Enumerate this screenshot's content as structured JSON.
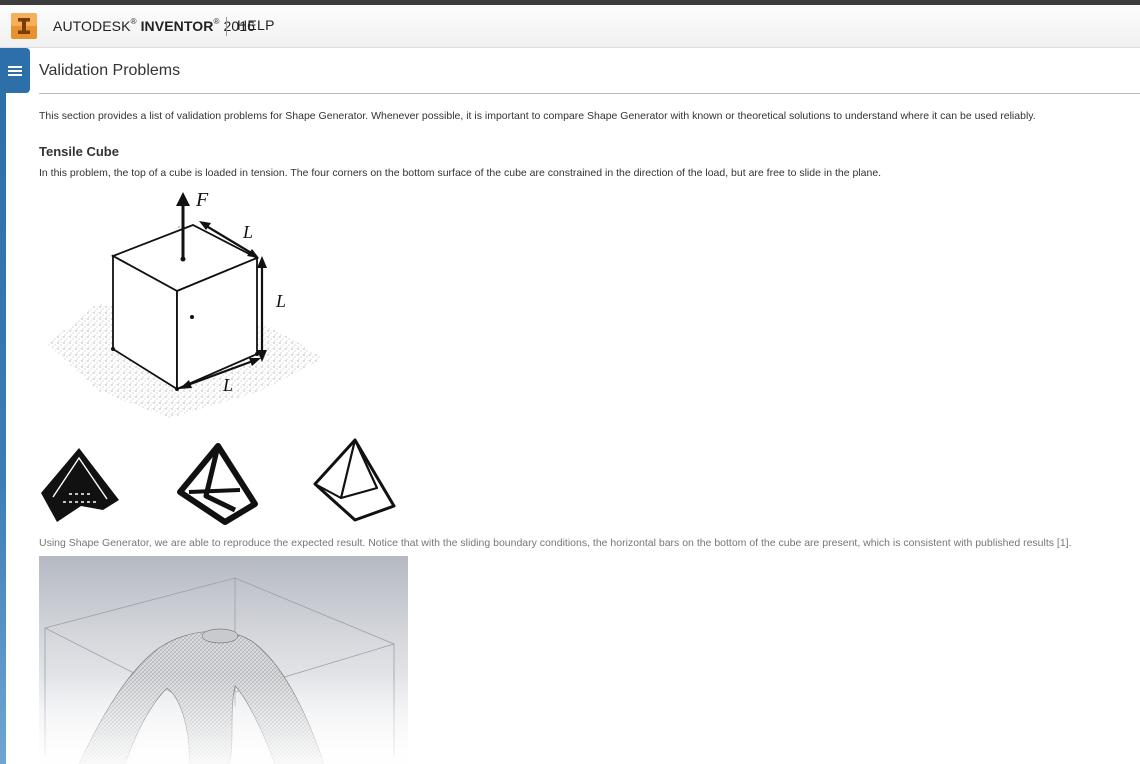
{
  "header": {
    "brand_prefix": "AUTODESK",
    "reg_mark": "®",
    "brand_product": "INVENTOR",
    "brand_year": " 2016",
    "help_label": "HELP"
  },
  "page": {
    "title": "Validation Problems",
    "intro": "This section provides a list of validation problems for Shape Generator. Whenever possible, it is important to compare Shape Generator with known or theoretical solutions to understand where it can be used reliably.",
    "section": {
      "heading": "Tensile Cube",
      "description": "In this problem, the top of a cube is loaded in tension. The four corners on the bottom surface of the cube are constrained in the direction of the load, but are free to slide in the plane.",
      "figure_labels": {
        "force": "F",
        "length": "L"
      },
      "caption": "Using Shape Generator, we are able to reproduce the expected result. Notice that with the sliding boundary conditions, the horizontal bars on the bottom of the cube are present, which is consistent with published results [1]."
    }
  },
  "colors": {
    "top_strip": "#3c3c3c",
    "toc_blue": "#2d6fa8",
    "logo_orange": "#e8912f"
  },
  "icons": {
    "logo": "inventor-logo-icon",
    "toc": "hamburger-menu-icon"
  }
}
